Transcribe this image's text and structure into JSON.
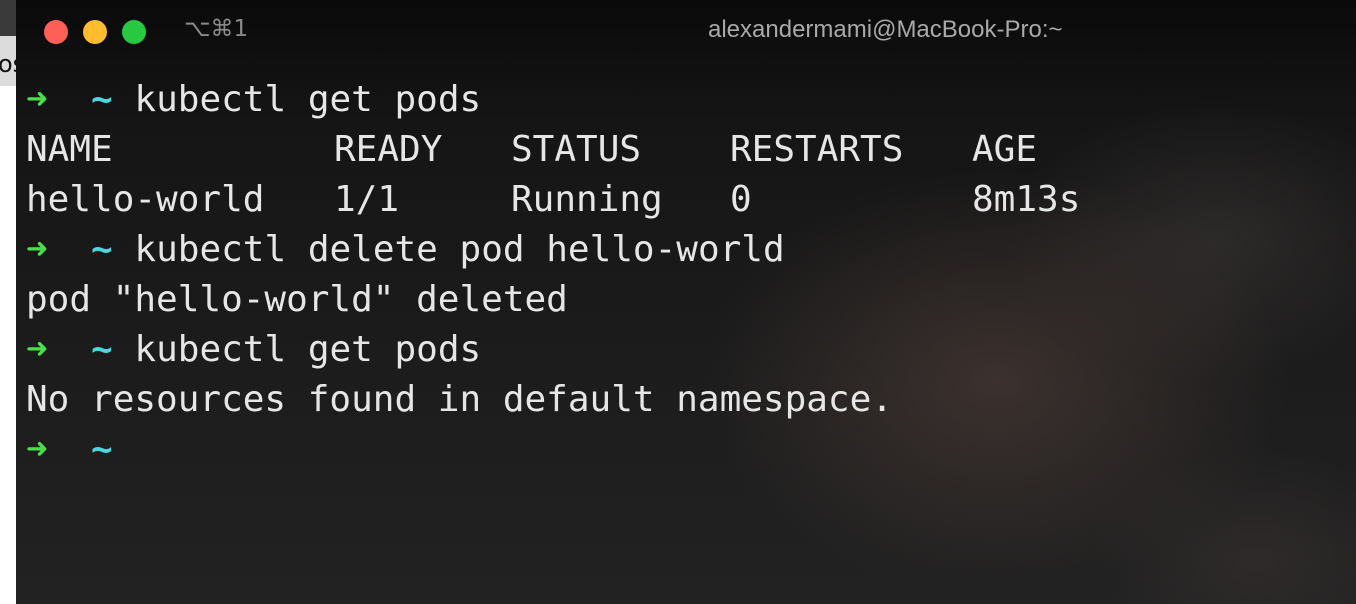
{
  "background_fragment": "os",
  "window": {
    "shortcut": "⌥⌘1",
    "title": "alexandermami@MacBook-Pro:~"
  },
  "colors": {
    "prompt_arrow": "#4be04b",
    "prompt_dir": "#49d7e0",
    "text": "#e6e6e6",
    "close": "#fe5f57",
    "minimize": "#febc2e",
    "zoom": "#28c840"
  },
  "prompt": {
    "arrow": "➜",
    "dir": "~"
  },
  "terminal": {
    "commands": [
      "kubectl get pods",
      "kubectl delete pod hello-world",
      "kubectl get pods"
    ],
    "table": {
      "headers": [
        "NAME",
        "READY",
        "STATUS",
        "RESTARTS",
        "AGE"
      ],
      "rows": [
        [
          "hello-world",
          "1/1",
          "Running",
          "0",
          "8m13s"
        ]
      ]
    },
    "outputs": [
      "pod \"hello-world\" deleted",
      "No resources found in default namespace."
    ]
  }
}
